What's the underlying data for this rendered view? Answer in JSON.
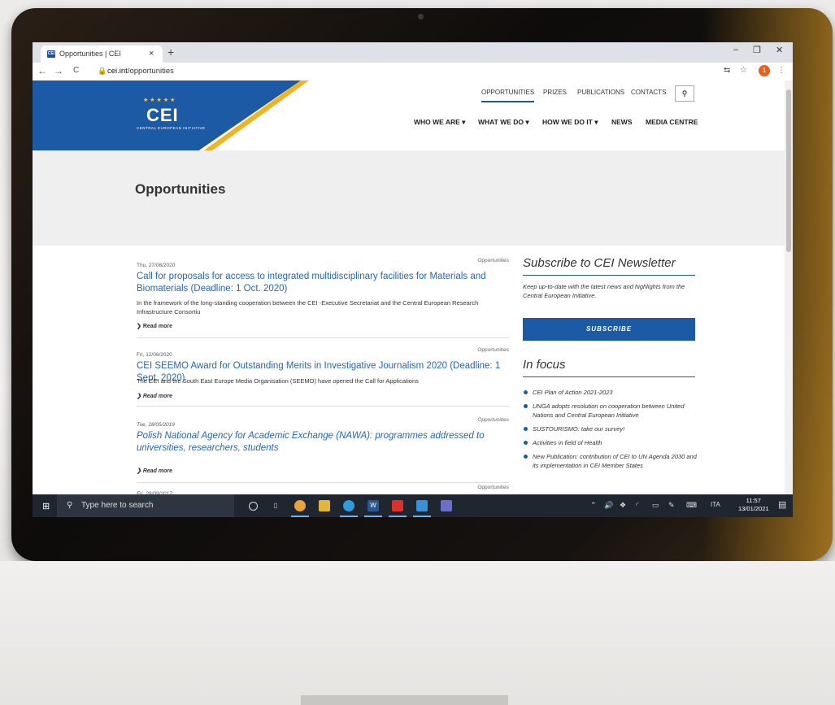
{
  "browser": {
    "tab_title": "Opportunities | CEI",
    "tab_favicon": "CEI",
    "tab_close": "×",
    "new_tab": "+",
    "window_controls": {
      "minimize": "–",
      "maximize": "❐",
      "close": "✕"
    },
    "nav": {
      "back": "←",
      "forward": "→",
      "reload": "C"
    },
    "url_host": "cei.int",
    "url_path": "/opportunities",
    "profile_badge": "1"
  },
  "site": {
    "logo_text": "CEI",
    "logo_stars": "★★★★★",
    "logo_subtitle": "CENTRAL EUROPEAN INITIATIVE",
    "top_links": [
      "OPPORTUNITIES",
      "PRIZES",
      "PUBLICATIONS",
      "CONTACTS"
    ],
    "main_nav": [
      "WHO WE ARE ▾",
      "WHAT WE DO ▾",
      "HOW WE DO IT ▾",
      "NEWS",
      "MEDIA CENTRE"
    ],
    "page_title": "Opportunities",
    "accent_blue": "#1d5aa6",
    "accent_gold": "#f2b221"
  },
  "posts": [
    {
      "date": "Thu, 27/08/2020",
      "category": "Opportunities",
      "title": "Call for proposals for access to integrated multidisciplinary facilities for Materials and Biomaterials (Deadline: 1 Oct. 2020)",
      "description": "In the framework of the long-standing cooperation between the CEI -Executive Secretariat and the Central European Research Infrastructure Consortiu",
      "more": "Read more"
    },
    {
      "date": "Fri, 12/06/2020",
      "category": "Opportunities",
      "title": "CEI SEEMO Award for Outstanding Merits in Investigative Journalism 2020 (Deadline: 1 Sept. 2020)",
      "description": "The CEI and the South East Europe Media Organisation (SEEMO) have opened the Call for Applications",
      "more": "Read more"
    },
    {
      "date": "Tue, 28/05/2019",
      "category": "Opportunities",
      "title": "Polish National Agency for Academic Exchange (NAWA): programmes addressed to universities, researchers, students",
      "description": "",
      "more": "Read more"
    },
    {
      "date": "Fri, 29/09/2017",
      "category": "Opportunities",
      "title": "",
      "description": "",
      "more": ""
    }
  ],
  "sidebar": {
    "newsletter_title": "Subscribe to CEI Newsletter",
    "newsletter_blurb": "Keep up-to-date with the latest news and highlights from the Central European Initiative.",
    "subscribe_label": "SUBSCRIBE",
    "focus_title": "In focus",
    "focus_items": [
      "CEI Plan of Action 2021-2023",
      "UNGA adopts resolution on cooperation between United Nations and Central European Initiative",
      "SUSTOURISMO: take our survey!",
      "Activities in field of Health",
      "New Publication: contribution of CEI to UN Agenda 2030 and its implementation in CEI Member States"
    ]
  },
  "taskbar": {
    "search_placeholder": "Type here to search",
    "language": "ITA",
    "time": "11:57",
    "date": "13/01/2021"
  }
}
